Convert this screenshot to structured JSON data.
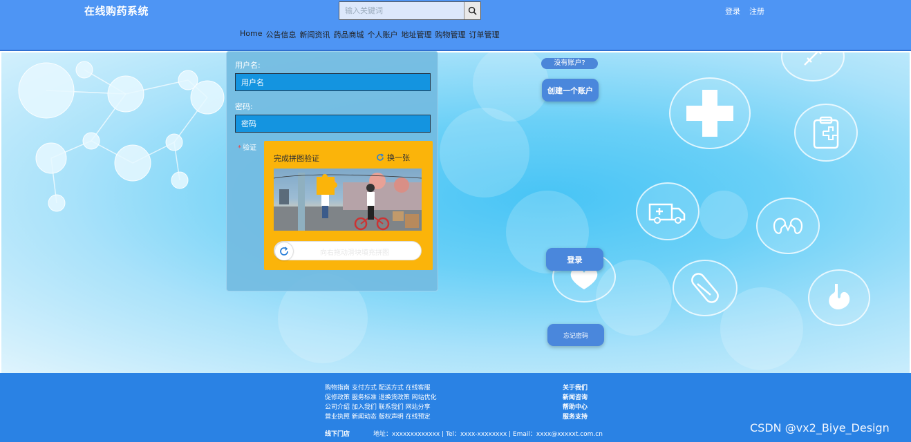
{
  "header": {
    "logo": "在线购药系统",
    "search_placeholder": "输入关键词",
    "links": [
      "登录",
      "注册"
    ],
    "nav": [
      "Home",
      "公告信息",
      "新闻资讯",
      "药品商城",
      "个人账户",
      "地址管理",
      "购物管理",
      "订单管理"
    ]
  },
  "login": {
    "username_label": "用户名:",
    "username_placeholder": "用户名",
    "password_label": "密码:",
    "password_placeholder": "密码",
    "verify_label": "验证",
    "captcha_title": "完成拼图验证",
    "captcha_refresh": "换一张",
    "slider_text": "向右拖动滑块填充拼图"
  },
  "side": {
    "no_account": "没有账户?",
    "create_account": "创建一个账户",
    "login_button": "登录",
    "forgot_password": "忘记密码"
  },
  "footer": {
    "links": [
      "购物指南 支付方式 配送方式 在线客服",
      "促修政策 服务标准 退换货政策 网站优化",
      "公司介绍 加入我们 联系我们 网站分享",
      "营业执照 新闻动态 版权声明 在线预定"
    ],
    "right": [
      "关于我们",
      "新闻咨询",
      "帮助中心",
      "服务支持"
    ],
    "store": "线下门店",
    "contact": "地址：xxxxxxxxxxxxx | Tel：xxxx-xxxxxxxx | Email：xxxx@xxxxxt.com.cn"
  },
  "watermark": "CSDN @vx2_Biye_Design",
  "colors": {
    "header": "#4e95f4",
    "footer": "#2a82e4",
    "input": "#1494e0",
    "captcha": "#fbb40a",
    "button": "#4a87dc"
  }
}
